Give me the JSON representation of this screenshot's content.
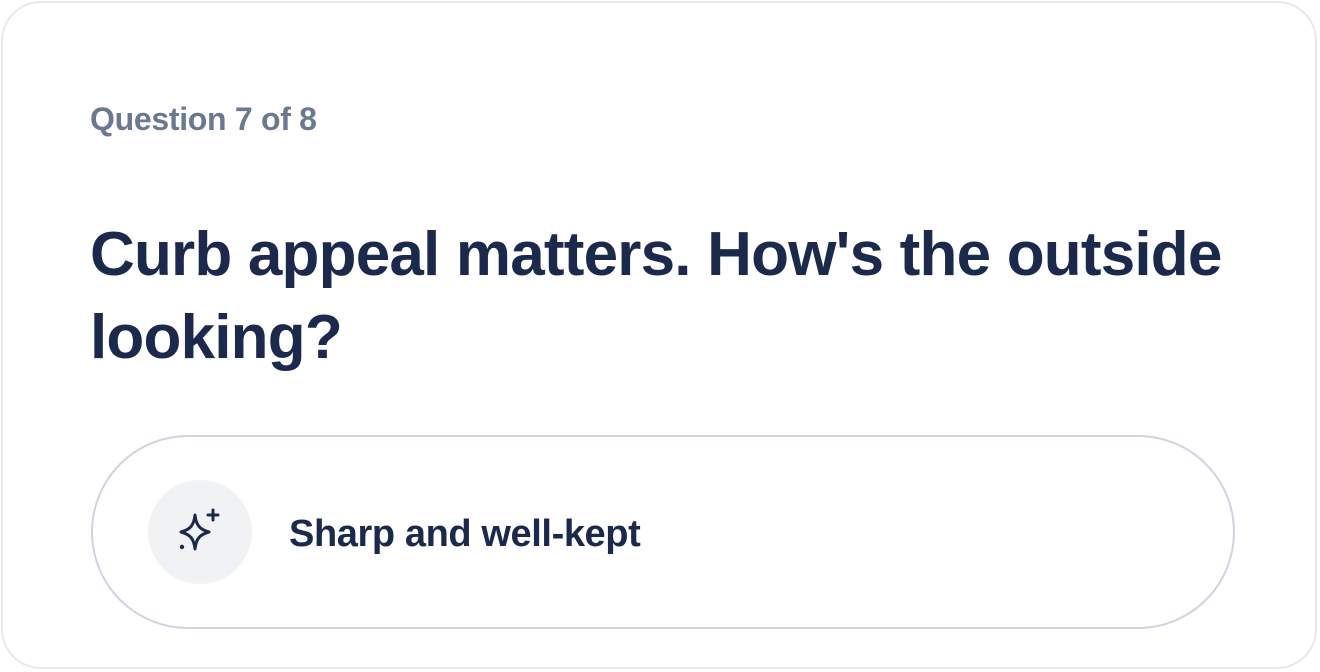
{
  "quiz": {
    "progress_text": "Question 7 of 8",
    "question": "Curb appeal matters. How's the outside looking?",
    "options": [
      {
        "label": "Sharp and well-kept",
        "icon": "sparkle-icon"
      }
    ]
  },
  "colors": {
    "text_primary": "#1b2a4c",
    "text_muted": "#6b7891",
    "border": "#cfd4de",
    "icon_background": "#f1f2f4"
  }
}
